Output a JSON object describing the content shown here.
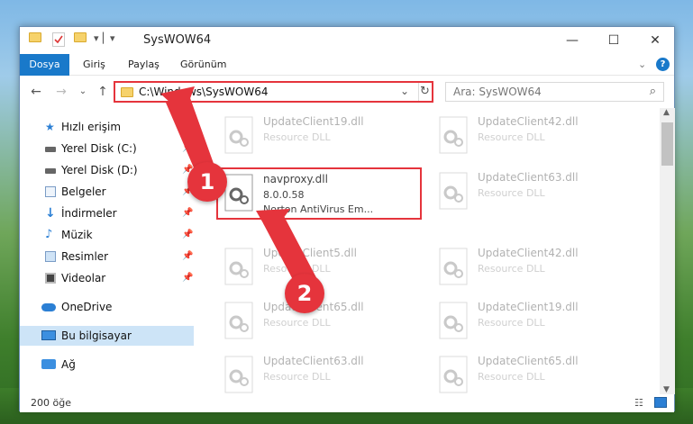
{
  "window": {
    "title": "SysWOW64"
  },
  "ribbon": {
    "tabs": [
      "Dosya",
      "Giriş",
      "Paylaş",
      "Görünüm"
    ]
  },
  "address": {
    "path": "C:\\Windows\\SysWOW64"
  },
  "search": {
    "placeholder": "Ara: SysWOW64"
  },
  "sidebar": {
    "items": [
      {
        "label": "Hızlı erişim",
        "icon": "star-icon",
        "pinned": false
      },
      {
        "label": "Yerel Disk (C:)",
        "icon": "drive-icon",
        "pinned": true
      },
      {
        "label": "Yerel Disk (D:)",
        "icon": "drive-icon",
        "pinned": true
      },
      {
        "label": "Belgeler",
        "icon": "document-icon",
        "pinned": true
      },
      {
        "label": "İndirmeler",
        "icon": "download-icon",
        "pinned": true
      },
      {
        "label": "Müzik",
        "icon": "music-icon",
        "pinned": true
      },
      {
        "label": "Resimler",
        "icon": "picture-icon",
        "pinned": true
      },
      {
        "label": "Videolar",
        "icon": "video-icon",
        "pinned": true
      },
      {
        "label": "OneDrive",
        "icon": "cloud-icon",
        "pinned": false
      },
      {
        "label": "Bu bilgisayar",
        "icon": "computer-icon",
        "pinned": false
      },
      {
        "label": "Ağ",
        "icon": "network-icon",
        "pinned": false
      }
    ]
  },
  "files": {
    "left": [
      {
        "name": "UpdateClient19.dll",
        "type": "Resource DLL"
      },
      {
        "name": "navproxy.dll",
        "version": "8.0.0.58",
        "company": "Norton AntiVirus Em..."
      },
      {
        "name": "UpdateClient5.dll",
        "type": "Resource DLL"
      },
      {
        "name": "UpdateClient65.dll",
        "type": "Resource DLL"
      },
      {
        "name": "UpdateClient63.dll",
        "type": "Resource DLL"
      }
    ],
    "right": [
      {
        "name": "UpdateClient42.dll",
        "type": "Resource DLL"
      },
      {
        "name": "UpdateClient63.dll",
        "type": "Resource DLL"
      },
      {
        "name": "UpdateClient42.dll",
        "type": "Resource DLL"
      },
      {
        "name": "UpdateClient19.dll",
        "type": "Resource DLL"
      },
      {
        "name": "UpdateClient65.dll",
        "type": "Resource DLL"
      }
    ]
  },
  "status": {
    "count": "200 öğe"
  },
  "annotations": {
    "step1": "1",
    "step2": "2"
  },
  "colors": {
    "accent": "#1979ca",
    "highlight": "#e5343c"
  }
}
